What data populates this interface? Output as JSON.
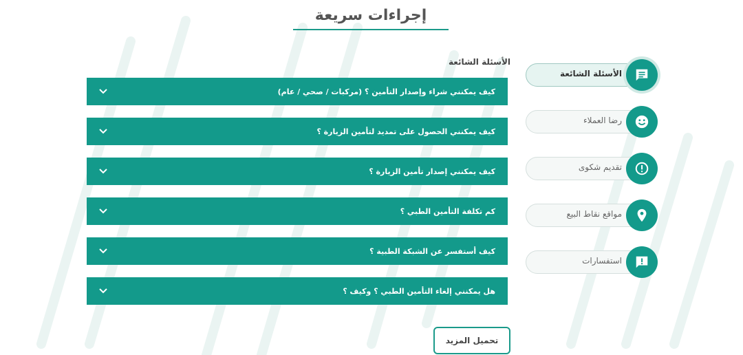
{
  "header": {
    "title": "إجراءات سريعة"
  },
  "faq": {
    "section_label": "الأسئلة الشائعة",
    "items": [
      {
        "q": "كيف يمكنني شراء وإصدار التأمين ؟ (مركبات / صحي / عام)"
      },
      {
        "q": "كيف يمكنني الحصول على تمديد لتأمين الزيارة ؟"
      },
      {
        "q": "كيف يمكنني إصدار تأمين الزيارة ؟"
      },
      {
        "q": "كم تكلفة التأمين الطبي ؟"
      },
      {
        "q": "كيف أستفسر عن الشبكة الطبية ؟"
      },
      {
        "q": "هل يمكنني إلغاء التأمين الطبي ؟ وكيف ؟"
      }
    ]
  },
  "sidebar": {
    "items": [
      {
        "label": "الأسئلة الشائعة",
        "icon": "chat-icon",
        "active": true
      },
      {
        "label": "رضا العملاء",
        "icon": "smiley-icon",
        "active": false
      },
      {
        "label": "تقديم شكوى",
        "icon": "alert-icon",
        "active": false
      },
      {
        "label": "مواقع نقاط البيع",
        "icon": "location-pin-icon",
        "active": false
      },
      {
        "label": "استفسارات",
        "icon": "feedback-icon",
        "active": false
      }
    ]
  },
  "load_more_label": "تحميل المزيد",
  "colors": {
    "accent": "#139a8b",
    "pill_bg": "#f5f8f7",
    "stripe": "#eef6f5"
  }
}
